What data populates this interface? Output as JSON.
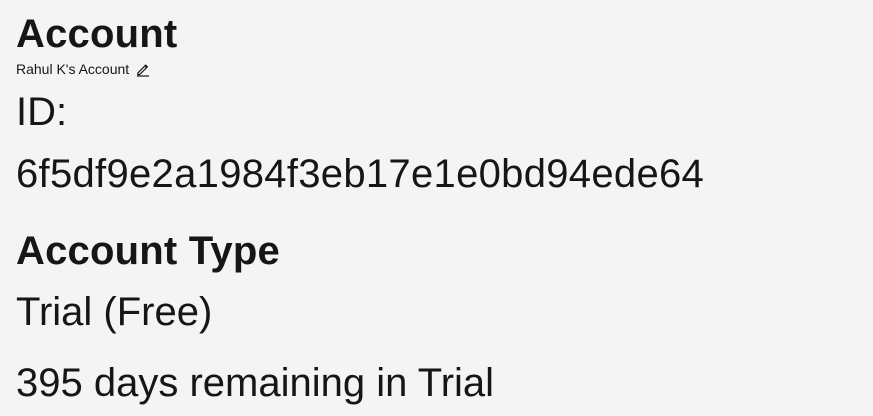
{
  "account": {
    "title": "Account",
    "name": "Rahul K's Account",
    "edit_icon": "pencil-icon",
    "id_label": "ID:",
    "id_value": "6f5df9e2a1984f3eb17e1e0bd94ede64"
  },
  "account_type": {
    "heading": "Account Type",
    "value": "Trial (Free)",
    "remaining": "395 days remaining in Trial"
  }
}
